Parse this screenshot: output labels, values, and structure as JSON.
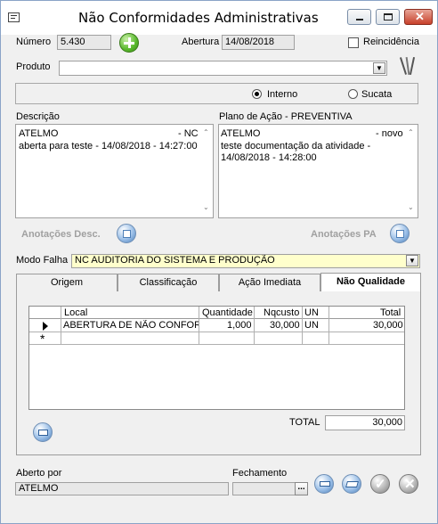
{
  "window": {
    "title": "Não Conformidades Administrativas"
  },
  "header": {
    "numero_label": "Número",
    "numero_value": "5.430",
    "abertura_label": "Abertura",
    "abertura_value": "14/08/2018",
    "reincidencia_label": "Reincidência",
    "produto_label": "Produto",
    "produto_value": ""
  },
  "origin": {
    "interno_label": "Interno",
    "sucata_label": "Sucata",
    "selected": "Interno"
  },
  "descricao": {
    "label": "Descrição",
    "line1_left": "ATELMO",
    "line1_right": "- NC",
    "line2": "aberta para teste - 14/08/2018 - 14:27:00"
  },
  "plano": {
    "label": "Plano de Ação - PREVENTIVA",
    "line1_left": "ATELMO",
    "line1_right": "- novo",
    "line2": "teste documentação da atividade -",
    "line3": "14/08/2018 - 14:28:00"
  },
  "anotacoes": {
    "desc_label": "Anotações Desc.",
    "pa_label": "Anotações PA"
  },
  "modo_falha": {
    "label": "Modo Falha",
    "value": "NC AUDITORIA DO SISTEMA E PRODUÇÃO"
  },
  "tabs": [
    {
      "label": "Origem"
    },
    {
      "label": "Classificação"
    },
    {
      "label": "Ação Imediata"
    },
    {
      "label": "Não Qualidade"
    }
  ],
  "grid": {
    "columns": [
      "Local",
      "Quantidade",
      "Nqcusto",
      "UN",
      "Total"
    ],
    "rows": [
      {
        "local": "ABERTURA DE NÃO CONFOR",
        "quantidade": "1,000",
        "nqcusto": "30,000",
        "un": "UN",
        "total": "30,000"
      }
    ],
    "new_row_marker": "*",
    "total_label": "TOTAL",
    "total_value": "30,000"
  },
  "footer": {
    "aberto_por_label": "Aberto por",
    "aberto_por_value": "ATELMO",
    "fechamento_label": "Fechamento",
    "fechamento_value": "",
    "ellipsis": "..."
  },
  "colors": {
    "accent_yellow": "#ffffcc",
    "add_green": "#58b82c"
  }
}
